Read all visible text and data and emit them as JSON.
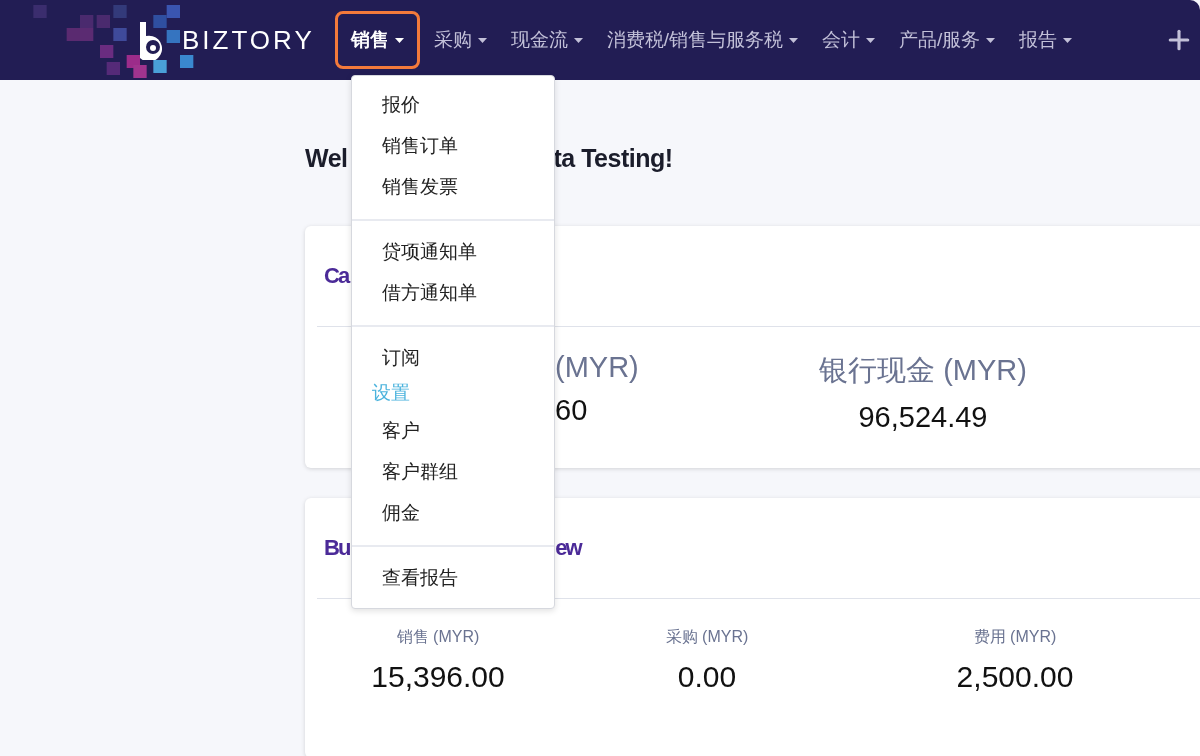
{
  "header": {
    "brand": "BIZTORY",
    "nav": [
      {
        "label": "销售",
        "selected": true
      },
      {
        "label": "采购",
        "selected": false
      },
      {
        "label": "现金流",
        "selected": false
      },
      {
        "label": "消费税/销售与服务税",
        "selected": false
      },
      {
        "label": "会计",
        "selected": false
      },
      {
        "label": "产品/服务",
        "selected": false
      },
      {
        "label": "报告",
        "selected": false
      }
    ]
  },
  "menu": {
    "groups": [
      {
        "items": [
          {
            "kind": "link",
            "label": "报价"
          },
          {
            "kind": "link",
            "label": "销售订单"
          },
          {
            "kind": "link",
            "label": "销售发票"
          }
        ]
      },
      {
        "items": [
          {
            "kind": "link",
            "label": "贷项通知单"
          },
          {
            "kind": "link",
            "label": "借方通知单"
          }
        ]
      },
      {
        "items": [
          {
            "kind": "link",
            "label": "订阅"
          },
          {
            "kind": "header",
            "label": "设置"
          },
          {
            "kind": "link",
            "label": "客户"
          },
          {
            "kind": "link",
            "label": "客户群组"
          },
          {
            "kind": "link",
            "label": "佣金"
          }
        ]
      },
      {
        "items": [
          {
            "kind": "link",
            "label": "查看报告"
          }
        ]
      }
    ]
  },
  "welcome": {
    "heading_parts": [
      "Wel",
      "ta Testing!"
    ]
  },
  "cash_card": {
    "title": "Ca",
    "metrics": [
      {
        "label": "(MYR)",
        "value": "60"
      },
      {
        "label": "银行现金 (MYR)",
        "value": "96,524.49"
      }
    ]
  },
  "business_card": {
    "title_parts": [
      "Bu",
      "ew"
    ],
    "metrics": [
      {
        "label": "销售 (MYR)",
        "value": "15,396.00"
      },
      {
        "label": "采购 (MYR)",
        "value": "0.00"
      },
      {
        "label": "费用 (MYR)",
        "value": "2,500.00"
      }
    ]
  }
}
